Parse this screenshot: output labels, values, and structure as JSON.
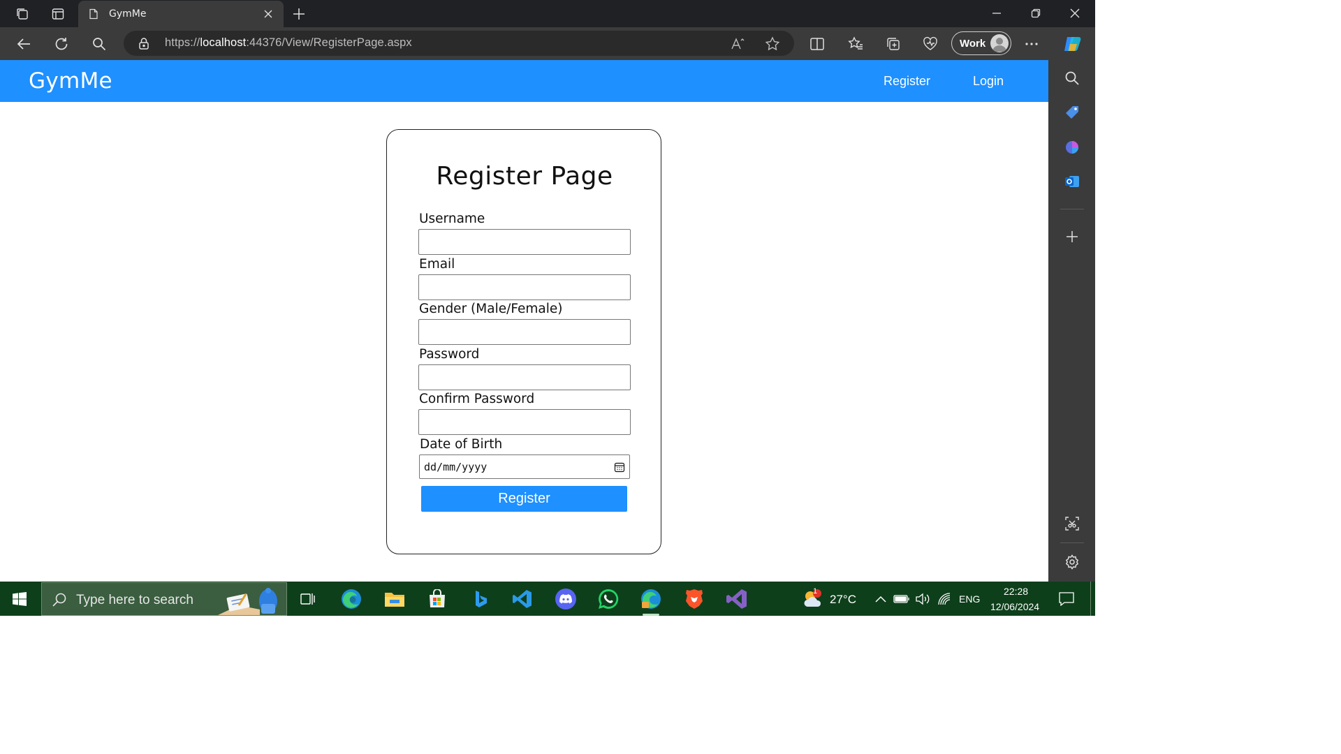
{
  "browser": {
    "tab_title": "GymMe",
    "url_prefix": "https://",
    "url_host": "localhost",
    "url_rest": ":44376/View/RegisterPage.aspx",
    "profile_label": "Work"
  },
  "navbar": {
    "brand": "GymMe",
    "links": [
      {
        "label": "Register"
      },
      {
        "label": "Login"
      }
    ]
  },
  "form": {
    "title": "Register Page",
    "fields": [
      {
        "label": "Username",
        "value": ""
      },
      {
        "label": "Email",
        "value": ""
      },
      {
        "label": "Gender (Male/Female)",
        "value": ""
      },
      {
        "label": "Password",
        "value": ""
      },
      {
        "label": "Confirm Password",
        "value": ""
      }
    ],
    "dob_label": "Date of Birth",
    "dob_placeholder": "dd/mm/yyyy",
    "submit_label": "Register"
  },
  "taskbar": {
    "search_placeholder": "Type here to search",
    "weather_temp": "27°C",
    "weather_badge": "1",
    "language": "ENG",
    "time": "22:28",
    "date": "12/06/2024"
  },
  "colors": {
    "accent": "#1e90ff",
    "chrome_dark": "#202124",
    "chrome": "#3b3b3b",
    "taskbar": "#0e3f1b"
  }
}
